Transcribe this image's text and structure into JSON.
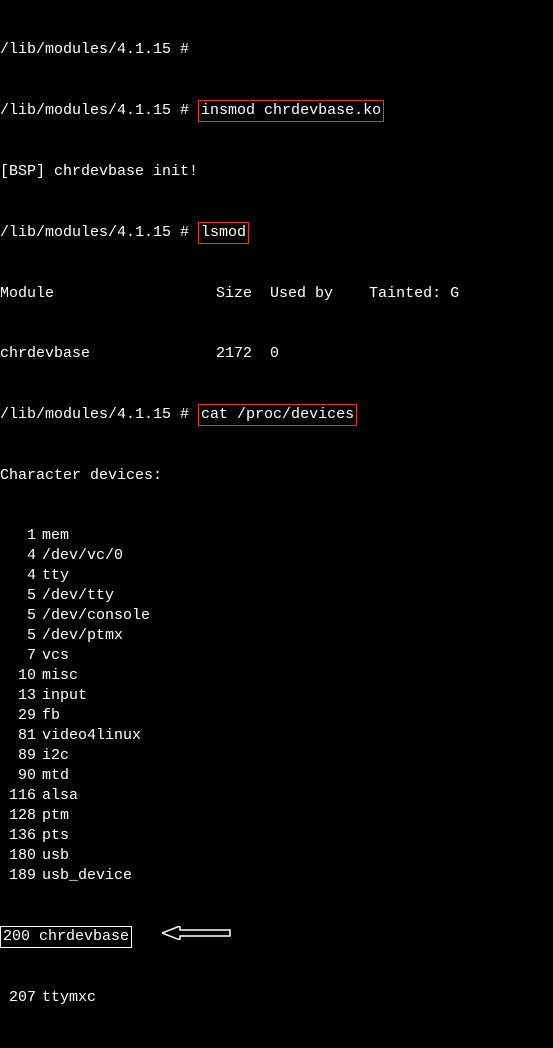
{
  "lines": {
    "cutoff_top": "/lib/modules/4.1.15 #",
    "prompt1_prefix": "/lib/modules/4.1.15 #",
    "cmd1": "insmod chrdevbase.ko",
    "bsp_init": "[BSP] chrdevbase init!",
    "prompt2_prefix": "/lib/modules/4.1.15 #",
    "cmd2": "lsmod",
    "lsmod_header": "Module                  Size  Used by    Tainted: G",
    "lsmod_row": "chrdevbase              2172  0",
    "prompt3_prefix": "/lib/modules/4.1.15 #",
    "cmd3": "cat /proc/devices",
    "char_devices_header": "Character devices:"
  },
  "devices": [
    {
      "num": "1",
      "name": "mem"
    },
    {
      "num": "4",
      "name": "/dev/vc/0"
    },
    {
      "num": "4",
      "name": "tty"
    },
    {
      "num": "5",
      "name": "/dev/tty"
    },
    {
      "num": "5",
      "name": "/dev/console"
    },
    {
      "num": "5",
      "name": "/dev/ptmx"
    },
    {
      "num": "7",
      "name": "vcs"
    },
    {
      "num": "10",
      "name": "misc"
    },
    {
      "num": "13",
      "name": "input"
    },
    {
      "num": "29",
      "name": "fb"
    },
    {
      "num": "81",
      "name": "video4linux"
    },
    {
      "num": "89",
      "name": "i2c"
    },
    {
      "num": "90",
      "name": "mtd"
    },
    {
      "num": "116",
      "name": "alsa"
    },
    {
      "num": "128",
      "name": "ptm"
    },
    {
      "num": "136",
      "name": "pts"
    },
    {
      "num": "180",
      "name": "usb"
    },
    {
      "num": "189",
      "name": "usb_device"
    }
  ],
  "highlighted_device": {
    "num": "200",
    "name": "chrdevbase"
  },
  "cutoff_device": {
    "num": "207",
    "name": "ttymxc"
  }
}
